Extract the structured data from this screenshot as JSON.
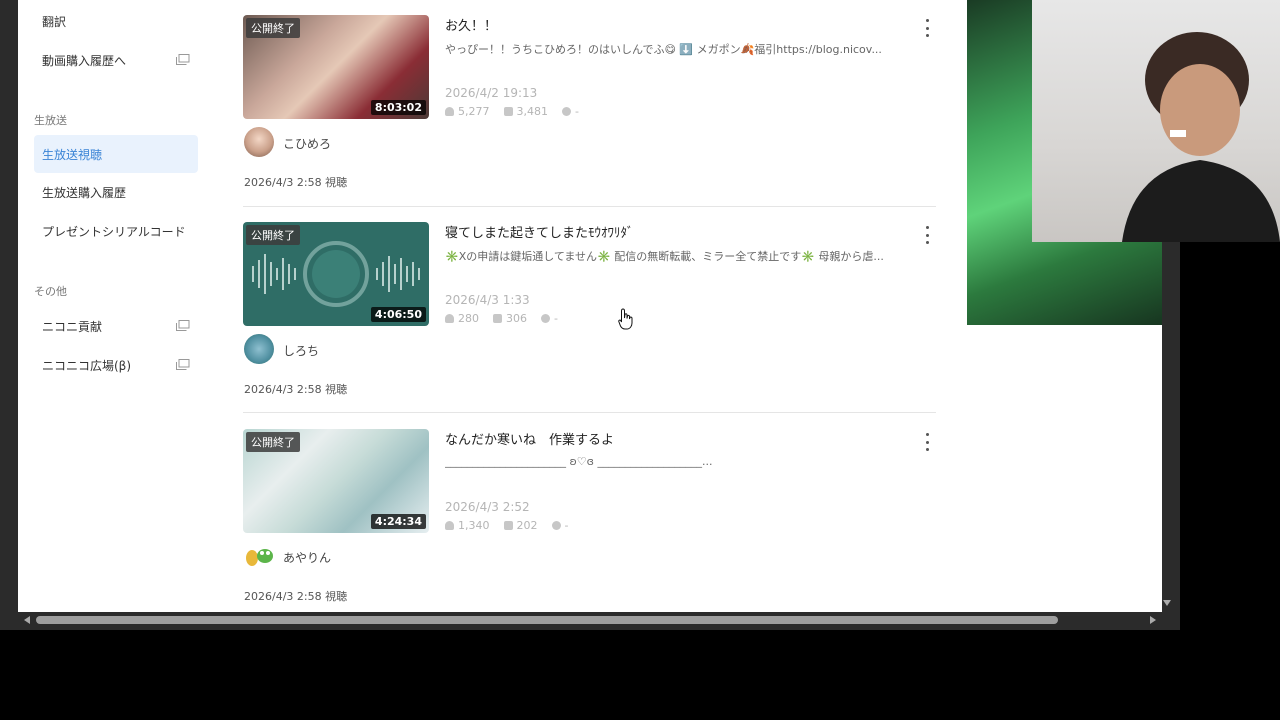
{
  "sidebar": {
    "items_top": [
      {
        "label": "翻訳",
        "external": false
      },
      {
        "label": "動画購入履歴へ",
        "external": true
      }
    ],
    "section_live": "生放送",
    "items_live": [
      {
        "label": "生放送視聴",
        "active": true
      },
      {
        "label": "生放送購入履歴",
        "active": false
      },
      {
        "label": "プレゼントシリアルコード",
        "active": false
      }
    ],
    "section_other": "その他",
    "items_other": [
      {
        "label": "ニコニ貢献",
        "external": true
      },
      {
        "label": "ニコニコ広場(β)",
        "external": true
      }
    ]
  },
  "history": [
    {
      "badge": "公開終了",
      "duration": "8:03:02",
      "title": "お久！！",
      "description": "やっぴー！！うちこひめろ！のはいしんでふ😋 ⬇️ メガポン🍂福引https://blog.nicov...",
      "date": "2026/4/2 19:13",
      "viewers": "5,277",
      "comments": "3,481",
      "extra": "-",
      "channel": "こひめろ",
      "watched": "2026/4/3 2:58 視聴"
    },
    {
      "badge": "公開終了",
      "duration": "4:06:50",
      "title": "寝てしまた起きてしまたﾓｳｵﾜﾘﾀﾞ",
      "description": "✳️Xの申請は鍵垢通してません✳️ 配信の無断転載、ミラー全て禁止です✳️ 母親から虐...",
      "date": "2026/4/3 1:33",
      "viewers": "280",
      "comments": "306",
      "extra": "-",
      "channel": "しろち",
      "watched": "2026/4/3 2:58 視聴"
    },
    {
      "badge": "公開終了",
      "duration": "4:24:34",
      "title": "なんだか寒いね　作業するよ",
      "description": "______________________ ʚ♡ɞ ___________________...",
      "date": "2026/4/3 2:52",
      "viewers": "1,340",
      "comments": "202",
      "extra": "-",
      "channel": "あやりん",
      "watched": "2026/4/3 2:58 視聴"
    }
  ],
  "icons": {
    "external": "external-window-icon",
    "more": "more-vertical-icon",
    "viewers": "person-icon",
    "comments": "comment-icon",
    "extra": "clock-icon"
  },
  "colors": {
    "active_bg": "#e9f2fd",
    "active_text": "#3a84d6",
    "page_bg": "#ffffff"
  }
}
